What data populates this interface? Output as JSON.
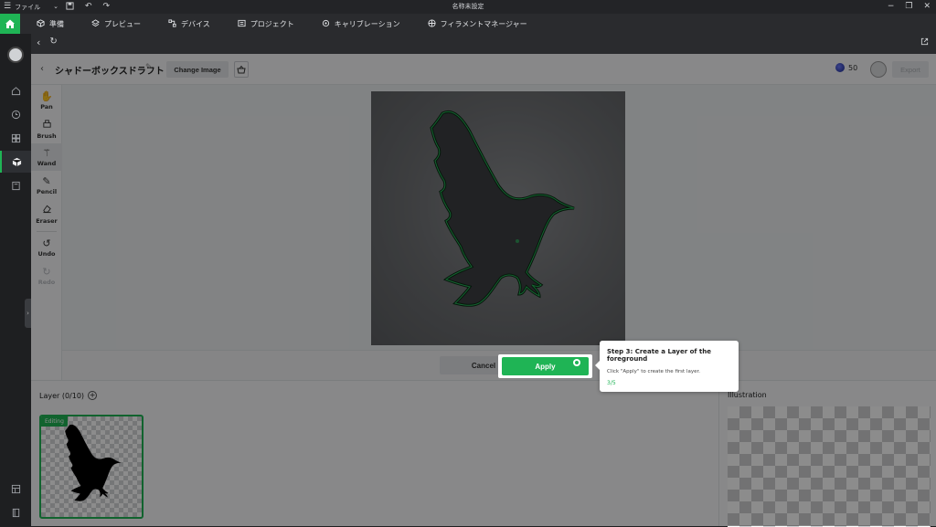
{
  "titlebar": {
    "menu_label": "ファイル",
    "window_title": "名称未設定"
  },
  "nav": {
    "tabs": [
      {
        "label": "準備",
        "icon": "cube-icon"
      },
      {
        "label": "プレビュー",
        "icon": "layers-icon"
      },
      {
        "label": "デバイス",
        "icon": "device-icon"
      },
      {
        "label": "プロジェクト",
        "icon": "project-icon"
      },
      {
        "label": "キャリブレーション",
        "icon": "calibration-icon"
      },
      {
        "label": "フィラメントマネージャー",
        "icon": "filament-icon"
      }
    ]
  },
  "header": {
    "title": "シャドーボックスドラフト",
    "change_image_label": "Change Image",
    "credits": "50",
    "export_label": "Export"
  },
  "tools": [
    {
      "label": "Pan",
      "icon": "hand-icon"
    },
    {
      "label": "Brush",
      "icon": "brush-icon"
    },
    {
      "label": "Wand",
      "icon": "wand-icon"
    },
    {
      "label": "Pencil",
      "icon": "pencil-icon"
    },
    {
      "label": "Eraser",
      "icon": "eraser-icon"
    },
    {
      "label": "Undo",
      "icon": "undo-icon"
    },
    {
      "label": "Redo",
      "icon": "redo-icon"
    }
  ],
  "actions": {
    "cancel_label": "Cancel",
    "apply_label": "Apply"
  },
  "layers": {
    "title": "Layer (0/10)",
    "editing_badge": "Editing"
  },
  "illustration": {
    "title": "Illustration"
  },
  "tooltip": {
    "title": "Step 3: Create a Layer of the foreground",
    "description": "Click \"Apply\" to create the first layer.",
    "step": "3/5"
  },
  "colors": {
    "accent": "#1fb455",
    "dark_bg": "#1e1f21"
  }
}
